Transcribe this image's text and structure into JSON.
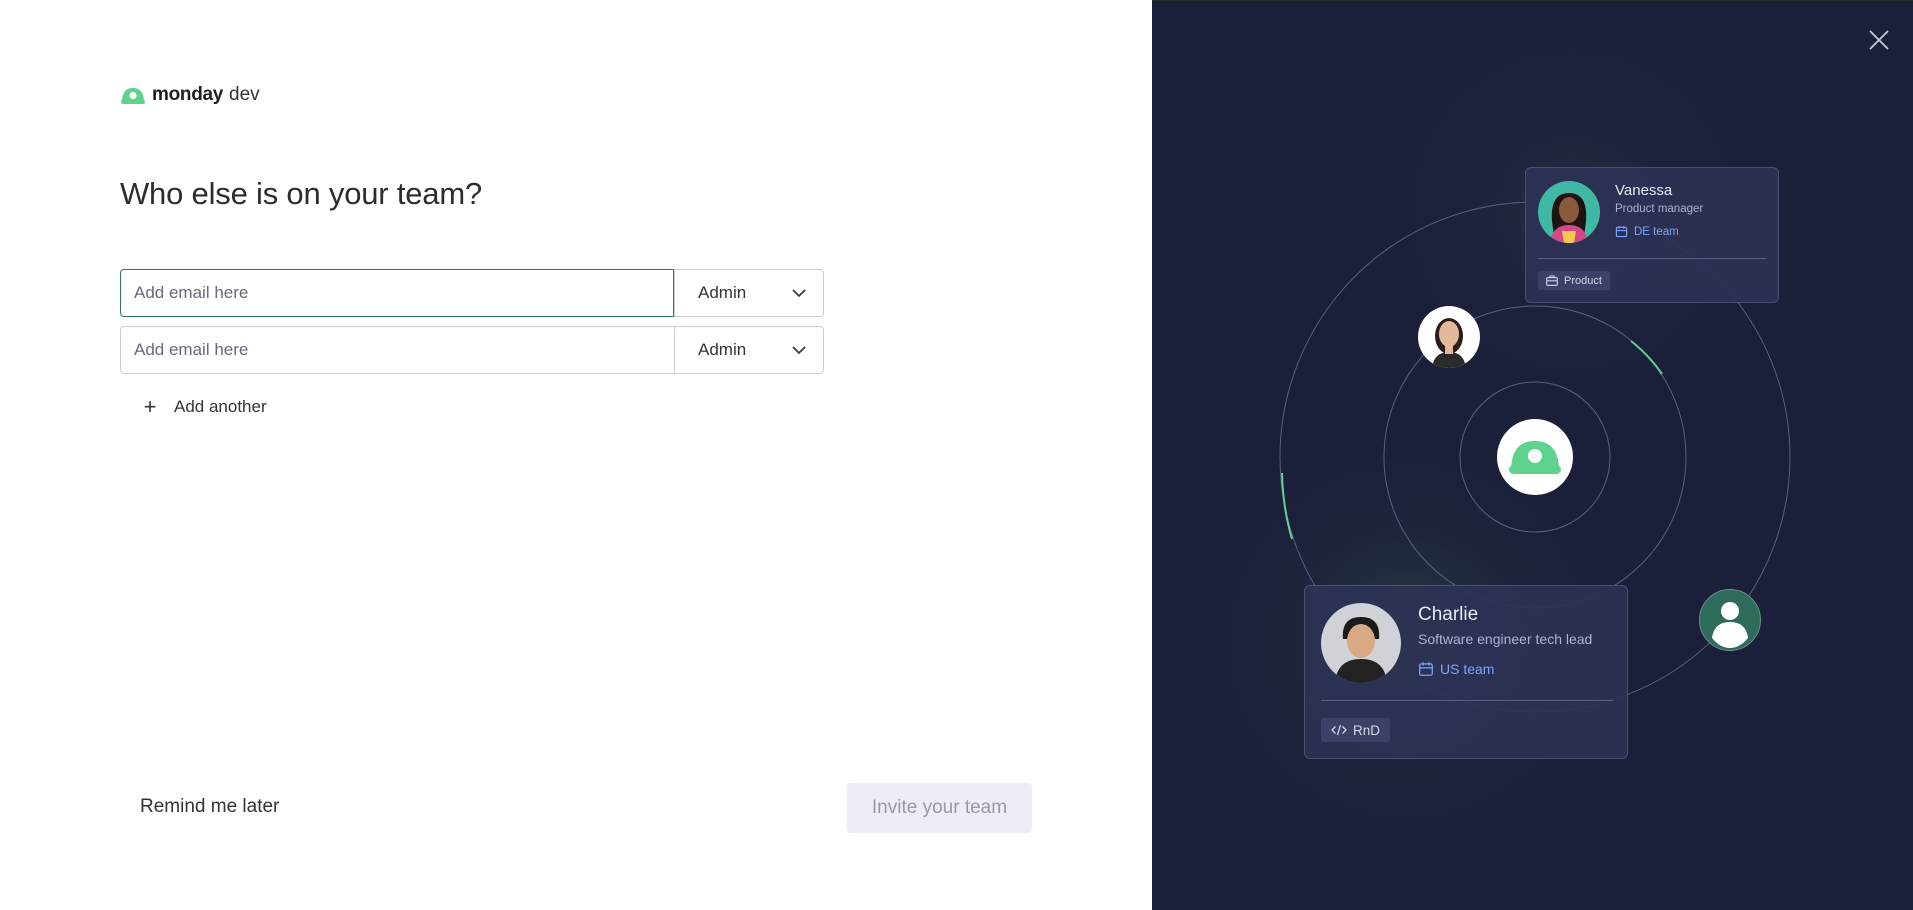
{
  "logo": {
    "brand": "monday",
    "product": "dev"
  },
  "heading": "Who else is on your team?",
  "invites": [
    {
      "email_placeholder": "Add email here",
      "email_value": "",
      "role": "Admin"
    },
    {
      "email_placeholder": "Add email here",
      "email_value": "",
      "role": "Admin"
    }
  ],
  "add_another": "Add another",
  "footer": {
    "remind_label": "Remind me later",
    "invite_label": "Invite your team"
  },
  "illustration": {
    "card_vanessa": {
      "name": "Vanessa",
      "role": "Product manager",
      "team": "DE team",
      "tag": "Product"
    },
    "card_charlie": {
      "name": "Charlie",
      "role": "Software engineer tech lead",
      "team": "US team",
      "tag": "RnD"
    }
  },
  "colors": {
    "accent_green": "#2f7d4a",
    "panel_bg": "#1c1f3a",
    "team_blue": "#7aa6ff",
    "brand_green": "#5fd38d"
  }
}
